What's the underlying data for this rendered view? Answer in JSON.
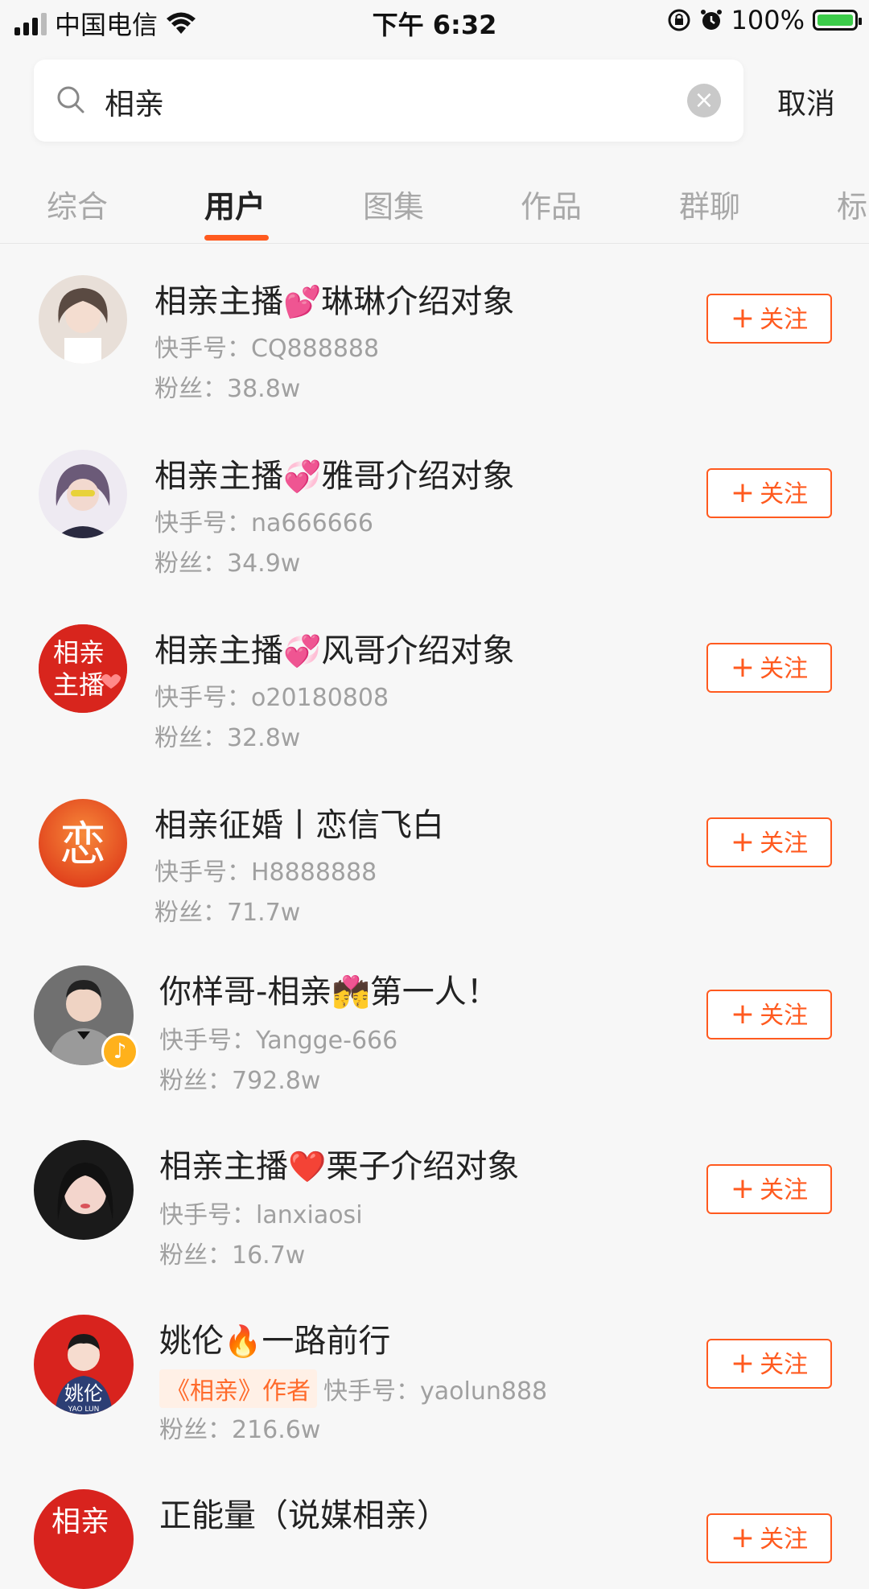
{
  "status": {
    "carrier": "中国电信",
    "time": "下午 6:32",
    "battery": "100%"
  },
  "search": {
    "query": "相亲",
    "cancel_label": "取消"
  },
  "tabs": [
    {
      "label": "综合"
    },
    {
      "label": "用户"
    },
    {
      "label": "图集"
    },
    {
      "label": "作品"
    },
    {
      "label": "群聊"
    },
    {
      "label": "标"
    }
  ],
  "active_tab": "用户",
  "follow_label": "关注",
  "users": [
    {
      "name_a": "相亲主播",
      "emoji": "💕",
      "name_b": "琳琳介绍对象",
      "id_label": "快手号：",
      "id": "CQ888888",
      "fans_label": "粉丝：",
      "fans": "38.8w"
    },
    {
      "name_a": "相亲主播",
      "emoji": "💞",
      "name_b": "雅哥介绍对象",
      "id_label": "快手号：",
      "id": "na666666",
      "fans_label": "粉丝：",
      "fans": "34.9w"
    },
    {
      "name_a": "相亲主播",
      "emoji": "💞",
      "name_b": "风哥介绍对象",
      "id_label": "快手号：",
      "id": "o20180808",
      "fans_label": "粉丝：",
      "fans": "32.8w"
    },
    {
      "name_a": "相亲征婚丨恋信飞白",
      "emoji": "",
      "name_b": "",
      "id_label": "快手号：",
      "id": "H8888888",
      "fans_label": "粉丝：",
      "fans": "71.7w",
      "avatar_text": "恋"
    },
    {
      "name_a": "你样哥-相亲",
      "emoji": "💏",
      "name_b": "第一人！",
      "id_label": "快手号：",
      "id": "Yangge-666",
      "fans_label": "粉丝：",
      "fans": "792.8w"
    },
    {
      "name_a": "相亲主播",
      "emoji": "❤️",
      "name_b": "栗子介绍对象",
      "id_label": "快手号：",
      "id": "lanxiaosi",
      "fans_label": "粉丝：",
      "fans": "16.7w"
    },
    {
      "name_a": "姚伦",
      "emoji": "🔥",
      "name_b": "一路前行",
      "tag": "《相亲》作者",
      "id_label": "快手号：",
      "id": "yaolun888",
      "fans_label": "粉丝：",
      "fans": "216.6w",
      "avatar_text": "姚伦"
    },
    {
      "name_a": "正能量（说媒相亲）",
      "emoji": "",
      "name_b": "",
      "avatar_text": "相亲"
    }
  ],
  "avatar_labels": {
    "matchmaker_line1": "相亲",
    "matchmaker_line2": "主播",
    "yaolun_sub": "YAO LUN"
  },
  "colors": {
    "accent": "#ff5a1f",
    "background": "#f7f7f7",
    "secondary_text": "#a0a0a0"
  }
}
